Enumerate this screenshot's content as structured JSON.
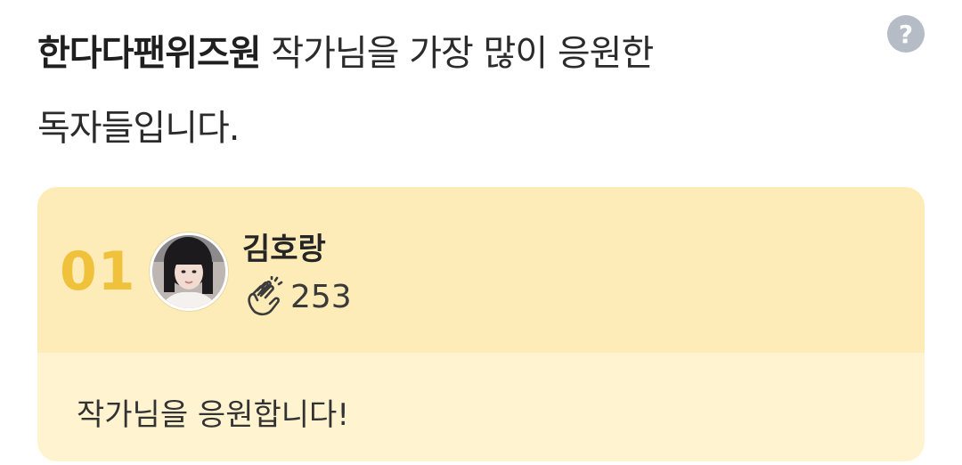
{
  "intro": {
    "fan_club_name": "한다다팬위즈원",
    "line1_rest": " 작가님을 가장 많이 응원한",
    "line2": "독자들입니다."
  },
  "help_icon": {
    "glyph": "?",
    "icon": "question-circle-icon"
  },
  "supporters": [
    {
      "rank": "01",
      "name": "김호랑",
      "clap_icon": "clapping-hands-icon",
      "clap_count": "253",
      "message": "작가님을 응원합니다!"
    }
  ],
  "colors": {
    "card_top": "#fdebb8",
    "card_bottom": "#fff3d0",
    "rank": "#f0c23c",
    "help_icon_bg": "#b5bcc6"
  }
}
